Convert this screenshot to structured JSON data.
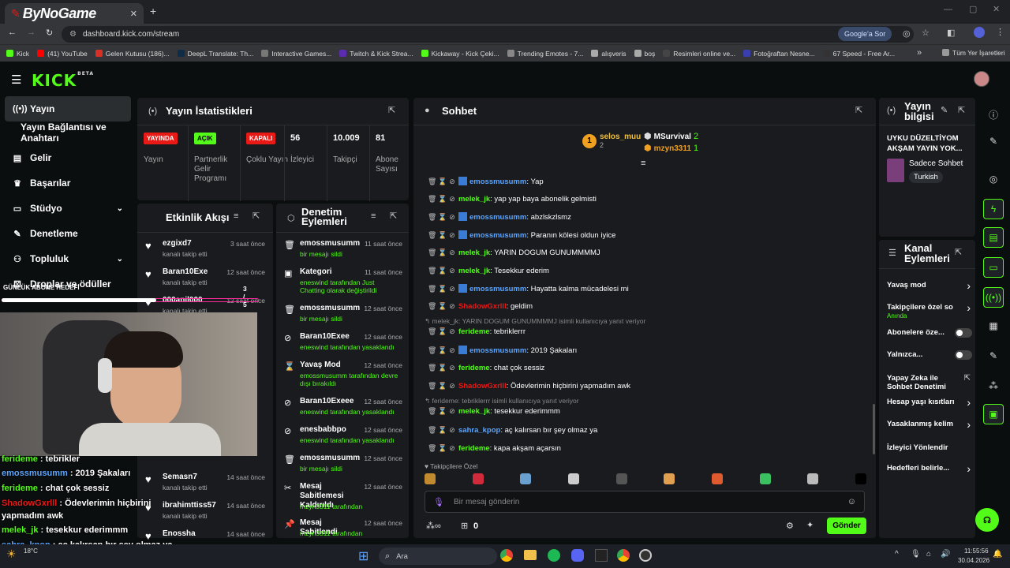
{
  "browser": {
    "tab_title": "ByNoGame",
    "url": "dashboard.kick.com/stream",
    "google_label": "Google'a Sor",
    "bookmarks": [
      "Kick",
      "(41) YouTube",
      "Gelen Kutusu (186)...",
      "DeepL Translate: Th...",
      "Interactive Games...",
      "Twitch & Kick Strea...",
      "Kickaway - Kick Çeki...",
      "Trending Emotes - 7...",
      "alışveris",
      "boş",
      "Resimleri online ve...",
      "Fotoğraftan Nesne...",
      "67 Speed - Free Ar..."
    ],
    "all_bookmarks": "Tüm Yer İşaretleri"
  },
  "brand": {
    "logo": "KICK",
    "beta": "BETA"
  },
  "nav": {
    "items": [
      {
        "label": "Yayın",
        "icon": "radio-icon"
      },
      {
        "label": "Yayın Bağlantısı ve Anahtarı",
        "icon": ""
      },
      {
        "label": "Gelir",
        "icon": "chart-icon"
      },
      {
        "label": "Başarılar",
        "icon": "trophy-icon"
      },
      {
        "label": "Stüdyo",
        "icon": "studio-icon"
      },
      {
        "label": "Denetleme",
        "icon": "wrench-icon"
      },
      {
        "label": "Topluluk",
        "icon": "people-icon"
      },
      {
        "label": "Droplar ve ödüller",
        "icon": "gift-icon"
      }
    ]
  },
  "stats": {
    "title": "Yayın İstatistikleri",
    "items": [
      {
        "badge": "YAYINDA",
        "label": "Yayın",
        "color": "#e91916"
      },
      {
        "badge": "AÇIK",
        "label": "Partnerlik Gelir Programı",
        "color": "#53fc18"
      },
      {
        "badge": "KAPALI",
        "label": "Çoklu Yayın",
        "color": "#e91916"
      },
      {
        "value": "56",
        "label": "İzleyici"
      },
      {
        "value": "10.009",
        "label": "Takipçi"
      },
      {
        "value": "81",
        "label": "Abone Sayısı"
      }
    ]
  },
  "activity": {
    "title": "Etkinlik Akışı",
    "items": [
      {
        "name": "ezgixd7",
        "sub": "kanalı takip etti",
        "time": "3 saat önce"
      },
      {
        "name": "Baran10Exe",
        "sub": "kanalı takip etti",
        "time": "12 saat önce"
      },
      {
        "name": "000anil000",
        "sub": "kanalı takip etti",
        "time": "12 saat önce"
      },
      {
        "name": "Semasn7",
        "sub": "kanalı takip etti",
        "time": "14 saat önce"
      },
      {
        "name": "ibrahimttiss57",
        "sub": "kanalı takip etti",
        "time": "14 saat önce"
      },
      {
        "name": "Enossha",
        "sub": "",
        "time": "14 saat önce"
      }
    ]
  },
  "moderation": {
    "title": "Denetim Eylemleri",
    "items": [
      {
        "name": "emossmusumm",
        "sub": "bir mesajı sildi",
        "time": "11 saat önce",
        "icon": "trash-icon"
      },
      {
        "name": "Kategori",
        "sub": "eneswind tarafından Just Chatting olarak değiştirildi",
        "time": "11 saat önce",
        "icon": "category-icon"
      },
      {
        "name": "emossmusumm",
        "sub": "bir mesajı sildi",
        "time": "12 saat önce",
        "icon": "trash-icon"
      },
      {
        "name": "Baran10Exee",
        "sub": "eneswind tarafından yasaklandı",
        "time": "12 saat önce",
        "icon": "ban-icon"
      },
      {
        "name": "Yavaş Mod",
        "sub": "emossmusumm tarafından devre dışı bırakıldı",
        "time": "12 saat önce",
        "icon": "slow-icon"
      },
      {
        "name": "Baran10Exeee",
        "sub": "eneswind tarafından yasaklandı",
        "time": "12 saat önce",
        "icon": "ban-icon"
      },
      {
        "name": "enesbabbpo",
        "sub": "eneswind tarafından yasaklandı",
        "time": "12 saat önce",
        "icon": "ban-icon"
      },
      {
        "name": "emossmusumm",
        "sub": "bir mesajı sildi",
        "time": "12 saat önce",
        "icon": "trash-icon"
      },
      {
        "name": "Mesaj Sabitlemesi Kaldırıldı",
        "sub": "mzyn3311 tarafından",
        "time": "12 saat önce",
        "icon": "unpin-icon"
      },
      {
        "name": "Mesaj Sabitlendi",
        "sub": "mzyn3311 tarafından",
        "time": "12 saat önce",
        "icon": "pin-icon"
      }
    ]
  },
  "chat": {
    "title": "Sohbet",
    "top": [
      {
        "name": "selos_muu",
        "count": "2",
        "rank": "1"
      },
      {
        "name": "MSurvival",
        "count": "2"
      },
      {
        "name": "mzyn3311",
        "count": "1"
      }
    ],
    "messages": [
      {
        "user": "emossmusumm",
        "color": "#5aa5ff",
        "text": ": Yap"
      },
      {
        "user": "melek_jk",
        "color": "#53fc18",
        "text": ": yap yap baya abonelik gelmisti"
      },
      {
        "user": "emossmusumm",
        "color": "#5aa5ff",
        "text": ": abzlskzlsmz"
      },
      {
        "user": "emossmusumm",
        "color": "#5aa5ff",
        "text": ": Paranın kölesi oldun iyice"
      },
      {
        "user": "melek_jk",
        "color": "#53fc18",
        "text": ": YARIN DOGUM GUNUMMMMJ"
      },
      {
        "user": "melek_jk",
        "color": "#53fc18",
        "text": ": Tesekkur ederim"
      },
      {
        "user": "emossmusumm",
        "color": "#5aa5ff",
        "text": ": Hayatta kalma mücadelesi mi"
      },
      {
        "user": "ShadowGxrlll",
        "color": "#e91916",
        "text": ": geldim"
      },
      {
        "user": "ferideme",
        "color": "#53fc18",
        "text": ": tebriklerrr"
      },
      {
        "user": "emossmusumm",
        "color": "#5aa5ff",
        "text": ": 2019 Şakaları"
      },
      {
        "user": "ferideme",
        "color": "#53fc18",
        "text": ": chat çok sessiz"
      },
      {
        "user": "ShadowGxrlll",
        "color": "#e91916",
        "text": ": Ödevlerimin hiçbirini yapmadım awk"
      },
      {
        "user": "melek_jk",
        "color": "#53fc18",
        "text": ": tesekkur ederimmm"
      },
      {
        "user": "sahra_kpop",
        "color": "#5aa5ff",
        "text": ": aç kalırsan bır şey olmaz ya"
      },
      {
        "user": "ferideme",
        "color": "#53fc18",
        "text": ": kapa akşam açarsın"
      }
    ],
    "reply1": "melek_jk: YARIN DOGUM GUNUMMMMJ isimli kullanıcıya yanıt veriyor",
    "reply2": "ferideme: tebriklerrr isimli kullanıcıya yanıt veriyor",
    "emote_label": "Takipçilere Özel",
    "placeholder": "Bir mesaj gönderin",
    "send": "Gönder",
    "count": "0"
  },
  "info": {
    "title": "Yayın bilgisi",
    "stream_title": "UYKU DÜZELTİYOM AKŞAM YAYIN YOK...",
    "category": "Sadece Sohbet",
    "language": "Turkish"
  },
  "channel": {
    "title": "Kanal Eylemleri",
    "items": [
      {
        "label": "Yavaş mod",
        "kind": "chevron"
      },
      {
        "label": "Takipçilere özel so",
        "sub": "Anında",
        "kind": "chevron"
      },
      {
        "label": "Abonelere öze...",
        "kind": "toggle"
      },
      {
        "label": "Yalnızca...",
        "kind": "toggle"
      },
      {
        "label": "Yapay Zeka ile Sohbet Denetimi",
        "kind": "link"
      },
      {
        "label": "Hesap yaşı kısıtları",
        "kind": "chevron"
      },
      {
        "label": "Yasaklanmış kelim",
        "kind": "chevron"
      },
      {
        "label": "İzleyici Yönlendir",
        "kind": "none"
      },
      {
        "label": "Hedefleri belirle...",
        "kind": "chevron"
      }
    ]
  },
  "overlay": {
    "goal": "GÜNLÜK ABONE HEDEFİ",
    "goal_count": "3 / 5",
    "goal_progress": 0.6,
    "lines": [
      {
        "user": "ferideme",
        "color": "#53fc18",
        "text": " : tebrikler"
      },
      {
        "user": "emossmusumm",
        "color": "#5aa5ff",
        "text": " : 2019 Şakaları"
      },
      {
        "user": "ferideme",
        "color": "#53fc18",
        "text": " : chat çok sessiz"
      },
      {
        "user": "ShadowGxrlll",
        "color": "#e91916",
        "text": " : Ödevlerimin hiçbirini"
      },
      {
        "user": "",
        "color": "#fff",
        "text": "yapmadım awk"
      },
      {
        "user": "melek_jk",
        "color": "#53fc18",
        "text": " : tesekkur ederimmm"
      },
      {
        "user": "sahra_kpop",
        "color": "#5aa5ff",
        "text": " : aç kalırsan bır şey olmaz ya"
      },
      {
        "user": "ferideme",
        "color": "#53fc18",
        "text": " : kapa akşam açarsın"
      }
    ]
  },
  "taskbar": {
    "search": "Ara",
    "time": "11:55:56",
    "date": "30.04.2026",
    "temp": "18°C"
  }
}
